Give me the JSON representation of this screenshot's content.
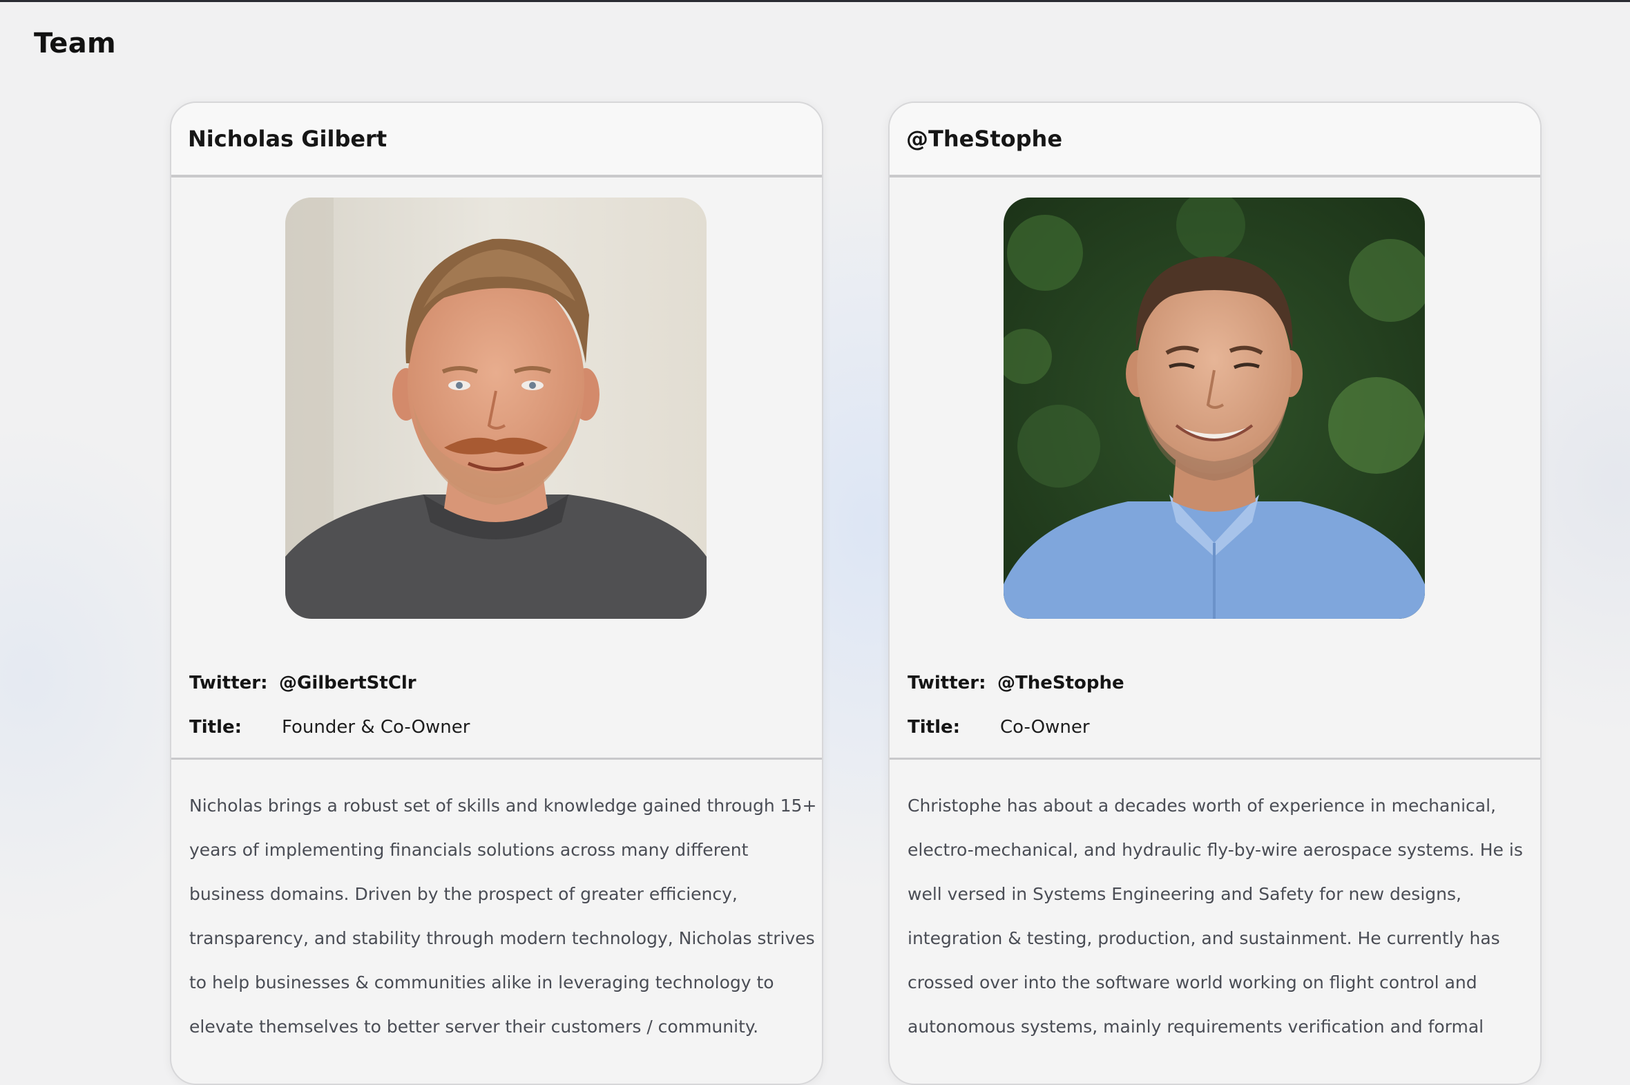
{
  "page": {
    "title": "Team"
  },
  "cards": [
    {
      "name": "Nicholas Gilbert",
      "twitter_label": "Twitter:",
      "twitter_handle": "@GilbertStClr",
      "title_label": "Title:",
      "title_value": "Founder & Co-Owner",
      "photo_icon": "portrait-photo",
      "bio_lines": [
        "Nicholas brings a robust set of skills and knowledge gained through 15+",
        "years of implementing financials solutions across many different",
        "business domains. Driven by the prospect of greater efficiency,",
        "transparency, and stability through modern technology, Nicholas strives",
        "to help businesses & communities alike in leveraging technology to",
        "elevate themselves to better server their customers / community."
      ]
    },
    {
      "name": "@TheStophe",
      "twitter_label": "Twitter:",
      "twitter_handle": "@TheStophe",
      "title_label": "Title:",
      "title_value": "Co-Owner",
      "photo_icon": "portrait-photo",
      "bio_lines": [
        "Christophe has about a decades worth of experience in mechanical,",
        "electro-mechanical, and hydraulic fly-by-wire aerospace systems. He is",
        "well versed in Systems Engineering and Safety for new designs,",
        "integration & testing, production, and sustainment. He currently has",
        "crossed over into the software world working on flight control and",
        "autonomous systems, mainly requirements verification and formal"
      ]
    }
  ],
  "colors": {
    "background": "#f1f1f2",
    "card_bg": "#f4f4f4",
    "divider": "#c9c9cb",
    "bio_text": "#4a4d55"
  }
}
